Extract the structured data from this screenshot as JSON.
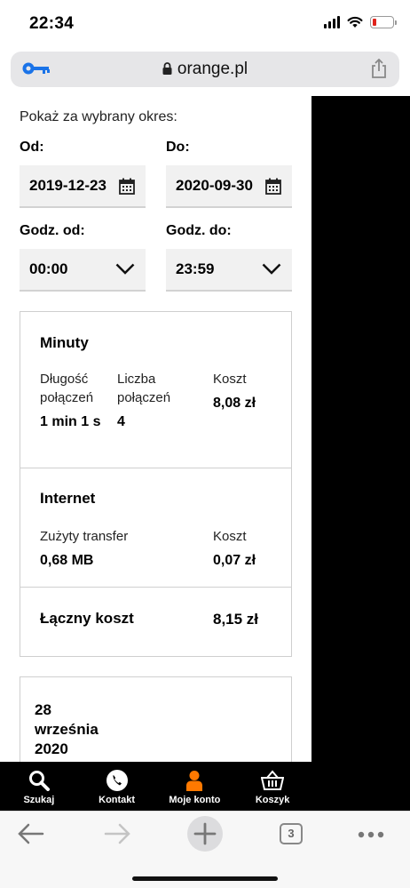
{
  "status": {
    "time": "22:34"
  },
  "browser": {
    "url": "orange.pl",
    "tab_count": "3"
  },
  "filters": {
    "period_label": "Pokaż za wybrany okres:",
    "from_label": "Od:",
    "to_label": "Do:",
    "from_date": "2019-12-23",
    "to_date": "2020-09-30",
    "time_from_label": "Godz. od:",
    "time_to_label": "Godz. do:",
    "time_from": "00:00",
    "time_to": "23:59"
  },
  "summary": {
    "minutes": {
      "title": "Minuty",
      "duration_label": "Długość połączeń",
      "duration_value": "1 min 1 s",
      "count_label": "Liczba połączeń",
      "count_value": "4",
      "cost_label": "Koszt",
      "cost_value": "8,08 zł"
    },
    "internet": {
      "title": "Internet",
      "transfer_label": "Zużyty transfer",
      "transfer_value": "0,68 MB",
      "cost_label": "Koszt",
      "cost_value": "0,07 zł"
    },
    "total": {
      "label": "Łączny koszt",
      "value": "8,15 zł"
    }
  },
  "day_card": {
    "date": "28 września 2020"
  },
  "site_nav": {
    "items": [
      {
        "label": "Szukaj",
        "icon": "search-icon"
      },
      {
        "label": "Kontakt",
        "icon": "phone-icon"
      },
      {
        "label": "Moje konto",
        "icon": "user-icon"
      },
      {
        "label": "Koszyk",
        "icon": "basket-icon"
      }
    ]
  },
  "colors": {
    "brand": "#ff7900",
    "nav_bg": "#000000",
    "battery_low": "#e0231c"
  }
}
